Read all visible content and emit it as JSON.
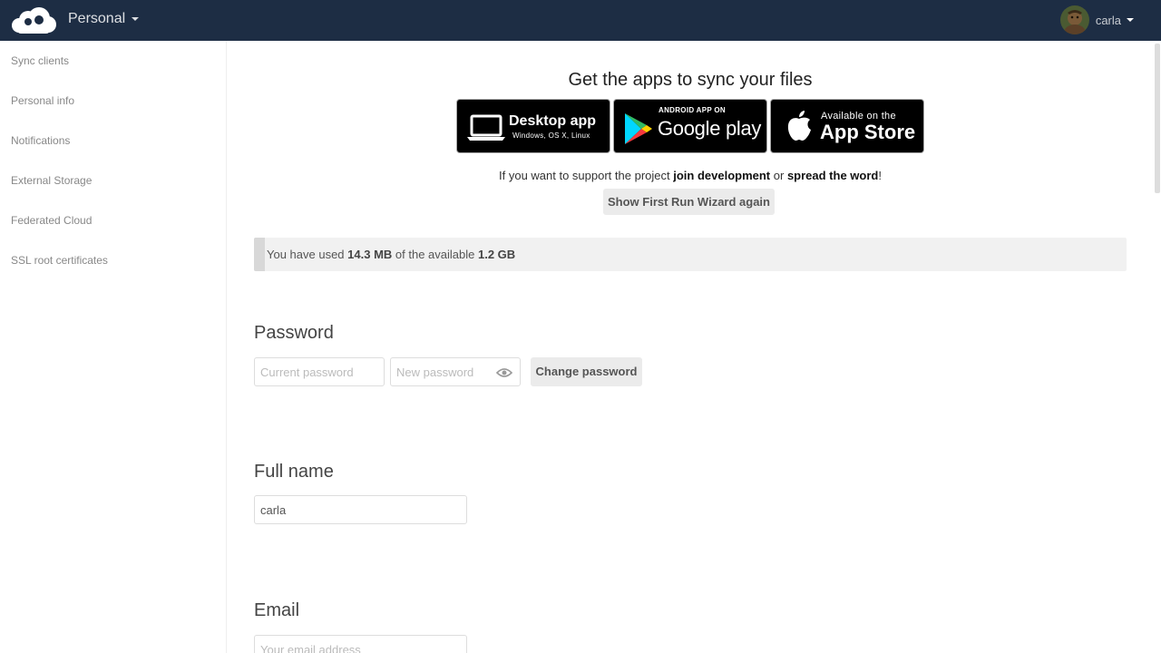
{
  "header": {
    "app_name": "Personal",
    "username": "carla",
    "background_color": "#1d2d44"
  },
  "sidebar": {
    "items": [
      {
        "label": "Sync clients"
      },
      {
        "label": "Personal info"
      },
      {
        "label": "Notifications"
      },
      {
        "label": "External Storage"
      },
      {
        "label": "Federated Cloud"
      },
      {
        "label": "SSL root certificates"
      }
    ]
  },
  "sync": {
    "title": "Get the apps to sync your files",
    "badges": {
      "desktop": {
        "big": "Desktop app",
        "small": "Windows, OS X, Linux"
      },
      "android": {
        "small": "ANDROID APP ON",
        "big": "Google play"
      },
      "ios": {
        "small": "Available on the",
        "big": "App Store"
      }
    },
    "support_prefix": "If you want to support the project ",
    "join_link": "join development",
    "support_or": " or ",
    "spread_link": "spread the word",
    "support_suffix": "!",
    "wizard_button": "Show First Run Wizard again"
  },
  "quota": {
    "prefix": "You have used ",
    "used": "14.3 MB",
    "middle": " of the available ",
    "total": "1.2 GB",
    "fill_fraction": 0.012
  },
  "password": {
    "title": "Password",
    "current_placeholder": "Current password",
    "new_placeholder": "New password",
    "change_button": "Change password"
  },
  "fullname": {
    "title": "Full name",
    "value": "carla"
  },
  "email": {
    "title": "Email",
    "placeholder": "Your email address"
  }
}
